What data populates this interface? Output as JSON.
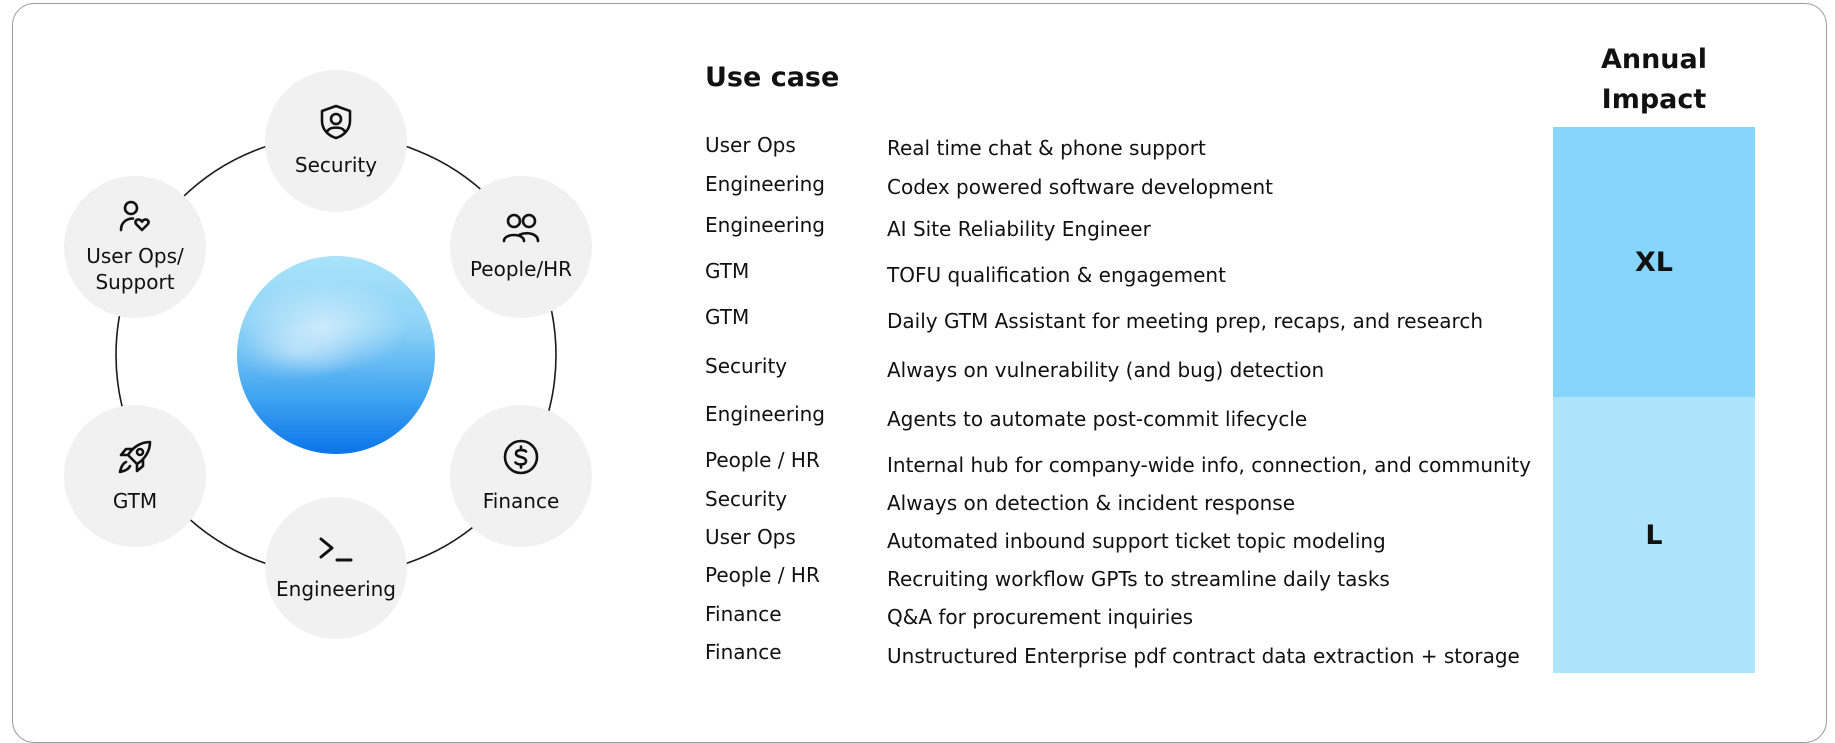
{
  "diagram": {
    "center_orb": "gradient-orb",
    "nodes": [
      {
        "id": "security",
        "label": "Security",
        "icon": "shield-user-icon"
      },
      {
        "id": "people-hr",
        "label": "People/HR",
        "icon": "people-icon"
      },
      {
        "id": "finance",
        "label": "Finance",
        "icon": "dollar-circle-icon"
      },
      {
        "id": "engineering",
        "label": "Engineering",
        "icon": "terminal-prompt-icon"
      },
      {
        "id": "gtm",
        "label": "GTM",
        "icon": "rocket-icon"
      },
      {
        "id": "user-ops",
        "label_line1": "User Ops/",
        "label_line2": "Support",
        "icon": "user-heart-icon"
      }
    ]
  },
  "use_case": {
    "title": "Use case",
    "rows": [
      {
        "category": "User Ops",
        "description": "Real time chat & phone support"
      },
      {
        "category": "Engineering",
        "description": "Codex powered software development"
      },
      {
        "category": "Engineering",
        "description": "AI Site Reliability Engineer"
      },
      {
        "category": "GTM",
        "description": "TOFU qualification & engagement"
      },
      {
        "category": "GTM",
        "description": "Daily GTM Assistant for meeting prep, recaps, and research"
      },
      {
        "category": "Security",
        "description": "Always on vulnerability (and bug) detection"
      },
      {
        "category": "Engineering",
        "description": "Agents to automate post-commit lifecycle"
      },
      {
        "category": "People / HR",
        "description": "Internal hub for company-wide info, connection, and community"
      },
      {
        "category": "Security",
        "description": "Always on detection & incident response"
      },
      {
        "category": "User Ops",
        "description": "Automated inbound support ticket topic modeling"
      },
      {
        "category": "People / HR",
        "description": "Recruiting workflow GPTs to streamline daily tasks"
      },
      {
        "category": "Finance",
        "description": "Q&A for procurement inquiries"
      },
      {
        "category": "Finance",
        "description": "Unstructured Enterprise pdf contract data extraction + storage"
      }
    ]
  },
  "annual_impact": {
    "title_line1": "Annual",
    "title_line2": "Impact",
    "tiers": [
      {
        "label": "XL",
        "color": "#86d6fb"
      },
      {
        "label": "L",
        "color": "#ade3fb"
      }
    ]
  },
  "colors": {
    "node_bg": "#f1f1f1",
    "orbit_line": "#1a1a1a",
    "frame_border": "#9a9a9a"
  }
}
